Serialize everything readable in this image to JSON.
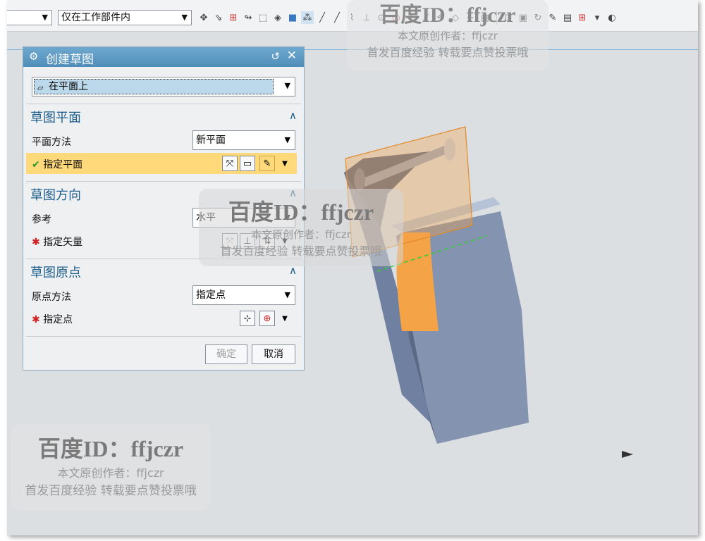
{
  "toolbar": {
    "left_dropdown_value": "",
    "filter_dropdown_value": "仅在工作部件内",
    "arrow_glyph": "▼"
  },
  "dialog": {
    "title": "创建草图",
    "reset_glyph": "↺",
    "close_glyph": "✕",
    "type_value": "在平面上",
    "sections": {
      "plane": {
        "title": "草图平面",
        "method_label": "平面方法",
        "method_value": "新平面",
        "specify_label": "指定平面"
      },
      "orientation": {
        "title": "草图方向",
        "reference_label": "参考",
        "reference_value": "水平",
        "specify_label": "指定矢量"
      },
      "origin": {
        "title": "草图原点",
        "method_label": "原点方法",
        "method_value": "指定点",
        "specify_label": "指定点"
      }
    },
    "ok_label": "确定",
    "cancel_label": "取消",
    "collapse_glyph": "∧"
  },
  "watermark": {
    "title": "百度ID：ffjczr",
    "line1": "本文原创作者：ffjczr",
    "line2": "首发百度经验 转载要点赞投票哦"
  },
  "colors": {
    "accent": "#4f8db8",
    "highlight": "#ffd97a",
    "section_title": "#1f5f8b",
    "model_body": "#7d8ea8",
    "model_inner": "#f4a347"
  }
}
